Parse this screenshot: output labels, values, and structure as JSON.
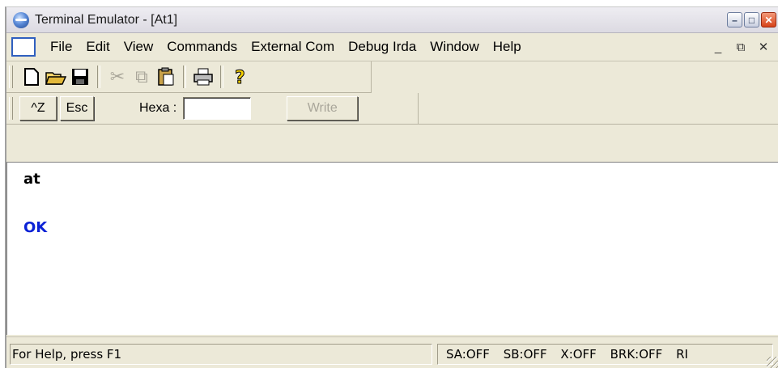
{
  "window": {
    "title": "Terminal Emulator - [At1]"
  },
  "menu": {
    "items": [
      "File",
      "Edit",
      "View",
      "Commands",
      "External Com",
      "Debug Irda",
      "Window",
      "Help"
    ]
  },
  "toolbar": {
    "icons": [
      "new-document-icon",
      "open-folder-icon",
      "save-icon",
      "cut-icon",
      "copy-icon",
      "paste-icon",
      "print-icon",
      "help-icon"
    ]
  },
  "command_bar": {
    "ctrl_z_label": "^Z",
    "esc_label": "Esc",
    "hexa_label": "Hexa :",
    "hexa_value": "",
    "write_label": "Write"
  },
  "terminal": {
    "lines": [
      {
        "text": "at",
        "color": "#000000"
      },
      {
        "text": "OK",
        "color": "#0b22d6"
      }
    ]
  },
  "status": {
    "help": "For Help, press F1",
    "indicators": [
      "SA:OFF",
      "SB:OFF",
      "X:OFF",
      "BRK:OFF",
      "RI"
    ]
  }
}
